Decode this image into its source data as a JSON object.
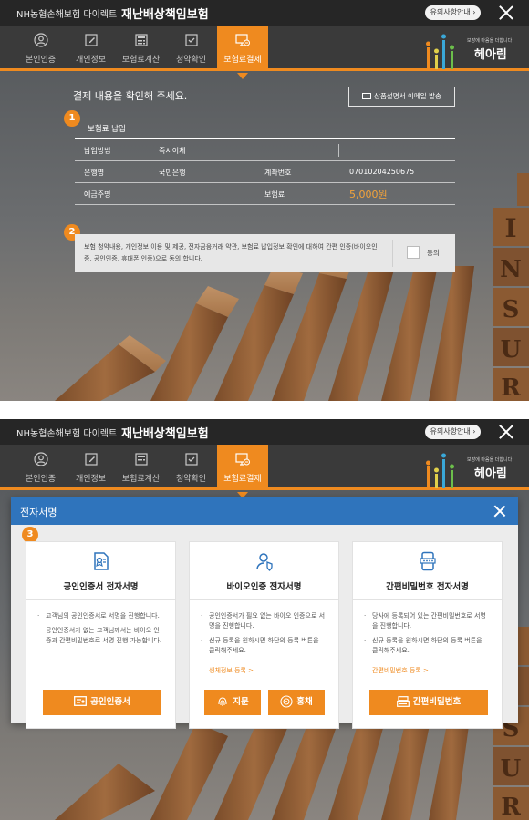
{
  "header": {
    "brand": "NH농협손해보험 다이렉트",
    "product": "재난배상책임보험",
    "notice_label": "유의사항안내 ›"
  },
  "nav": {
    "items": [
      {
        "label": "본인인증",
        "icon": "person-circle-icon"
      },
      {
        "label": "개인정보",
        "icon": "edit-note-icon"
      },
      {
        "label": "보험료계산",
        "icon": "calculator-icon"
      },
      {
        "label": "청약확인",
        "icon": "checkbox-icon"
      },
      {
        "label": "보험료결제",
        "icon": "monitor-card-icon"
      }
    ],
    "active_index": 4
  },
  "logo": {
    "tagline": "보장에 마음을 더합니다",
    "name": "헤아림"
  },
  "payment": {
    "confirm_title": "결제 내용을 확인해 주세요.",
    "email_button": "상품설명서 이메일 발송",
    "step1_number": "1",
    "section_title": "보험료 납입",
    "rows": {
      "method_label": "납입방법",
      "method_value": "즉시이체",
      "bank_label": "은행명",
      "bank_value": "국민은행",
      "account_label": "계좌번호",
      "account_value": "07010204250675",
      "holder_label": "예금주명",
      "holder_value": "",
      "premium_label": "보험료",
      "premium_value": "5,000원"
    },
    "step2_number": "2",
    "consent_text": "보험 청약내용, 개인정보 이용 및 제공, 전자금융거래 약관, 보험료 납입정보 확인에 대하여 간편 인증(바이오인증, 공인인증, 휴대폰 인증)으로 동의 합니다.",
    "consent_agree_label": "동의"
  },
  "modal": {
    "title": "전자서명",
    "step3_number": "3",
    "cards": [
      {
        "title": "공인인증서 전자서명",
        "items": [
          "고객님의 공인인증서로 서명을 진행합니다.",
          "공인인증서가 없는 고객님께서는 바이오 인증과 간편비밀번호로 서명 진행 가능합니다."
        ],
        "link": "",
        "buttons": [
          "공인인증서"
        ]
      },
      {
        "title": "바이오인증 전자서명",
        "items": [
          "공인인증서가 필요 없는 바이오 인증으로 서명을 진행합니다.",
          "신규 등록을 원하시면 하단의 등록 버튼을 클릭해주세요."
        ],
        "link": "생체정보 등록 >",
        "buttons": [
          "지문",
          "홍채"
        ]
      },
      {
        "title": "간편비밀번호 전자서명",
        "items": [
          "당사에 등록되어 있는 간편비밀번호로 서명을 진행합니다.",
          "신규 등록을 원하시면 하단의 등록 버튼을 클릭해주세요."
        ],
        "link": "간편비밀번호 등록 >",
        "buttons": [
          "간편비밀번호"
        ]
      }
    ]
  },
  "background": {
    "blocks_text": "INSURE"
  },
  "colors": {
    "accent": "#ef8a1f",
    "modal_header": "#2f74bc",
    "topbar": "#262626",
    "navbar": "#3a3a3a",
    "premium_value": "#f3a33a"
  }
}
